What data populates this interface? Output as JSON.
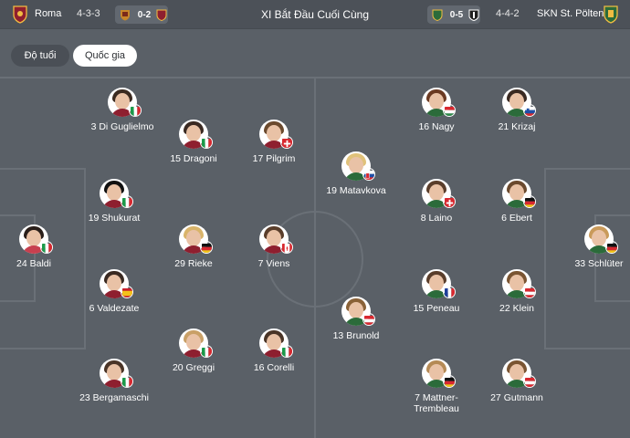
{
  "header": {
    "title": "XI Bắt Đầu Cuối Cùng",
    "home": {
      "name": "Roma",
      "formation": "4-3-3",
      "last_score": "0-2"
    },
    "away": {
      "name": "SKN St. Pölten",
      "formation": "4-4-2",
      "last_score": "0-5"
    }
  },
  "toggles": {
    "age": "Độ tuổi",
    "nationality": "Quốc gia"
  },
  "colors": {
    "background": "#5a6067",
    "topbar": "#4c5158",
    "roma": "#8e1f2f",
    "roma_gold": "#f0bc42"
  },
  "home_players": [
    {
      "label": "24 Baldi",
      "flag": "italy",
      "hair": "#2a1f1a",
      "shirt": "#c7404f"
    },
    {
      "label": "3 Di Guglielmo",
      "flag": "italy",
      "hair": "#3b2a20",
      "shirt": "#8e1f2f"
    },
    {
      "label": "19 Shukurat",
      "flag": "italy",
      "hair": "#111111",
      "shirt": "#8e1f2f"
    },
    {
      "label": "6 Valdezate",
      "flag": "spain",
      "hair": "#3a2a22",
      "shirt": "#8e1f2f"
    },
    {
      "label": "23 Bergamaschi",
      "flag": "italy",
      "hair": "#4a3527",
      "shirt": "#8e1f2f"
    },
    {
      "label": "15 Dragoni",
      "flag": "italy",
      "hair": "#3a2a22",
      "shirt": "#8e1f2f"
    },
    {
      "label": "29 Rieke",
      "flag": "germany",
      "hair": "#d9b46a",
      "shirt": "#8e1f2f"
    },
    {
      "label": "20 Greggi",
      "flag": "italy",
      "hair": "#c9a067",
      "shirt": "#8e1f2f"
    },
    {
      "label": "17 Pilgrim",
      "flag": "switzerland",
      "hair": "#6b4a2e",
      "shirt": "#8e1f2f"
    },
    {
      "label": "7 Viens",
      "flag": "canada",
      "hair": "#5a3e2b",
      "shirt": "#8e1f2f"
    },
    {
      "label": "16 Corelli",
      "flag": "italy",
      "hair": "#4a3527",
      "shirt": "#8e1f2f"
    }
  ],
  "away_players": [
    {
      "label": "19 Matavkova",
      "flag": "slovakia",
      "hair": "#e0c27a",
      "shirt": "#2b6b3a"
    },
    {
      "label": "16 Nagy",
      "flag": "hungary",
      "hair": "#6b3a22",
      "shirt": "#2b6b3a"
    },
    {
      "label": "8 Laino",
      "flag": "switzerland",
      "hair": "#5a3e2b",
      "shirt": "#2b6b3a"
    },
    {
      "label": "15 Peneau",
      "flag": "france",
      "hair": "#5a3e2b",
      "shirt": "#2b6b3a"
    },
    {
      "label": "7 Mattner-Trembleau",
      "flag": "germany",
      "hair": "#b58a55",
      "shirt": "#2b6b3a"
    },
    {
      "label": "13 Brunold",
      "flag": "austria",
      "hair": "#8a6238",
      "shirt": "#2b6b3a"
    },
    {
      "label": "21 Krizaj",
      "flag": "slovenia",
      "hair": "#3a2a22",
      "shirt": "#2b6b3a"
    },
    {
      "label": "6 Ebert",
      "flag": "germany",
      "hair": "#6b4a2e",
      "shirt": "#2b6b3a"
    },
    {
      "label": "22 Klein",
      "flag": "austria",
      "hair": "#7a5532",
      "shirt": "#2b6b3a"
    },
    {
      "label": "27 Gutmann",
      "flag": "austria",
      "hair": "#7a5532",
      "shirt": "#2b6b3a"
    },
    {
      "label": "33 Schlüter",
      "flag": "germany",
      "hair": "#c99a5a",
      "shirt": "#2b6b3a"
    }
  ]
}
